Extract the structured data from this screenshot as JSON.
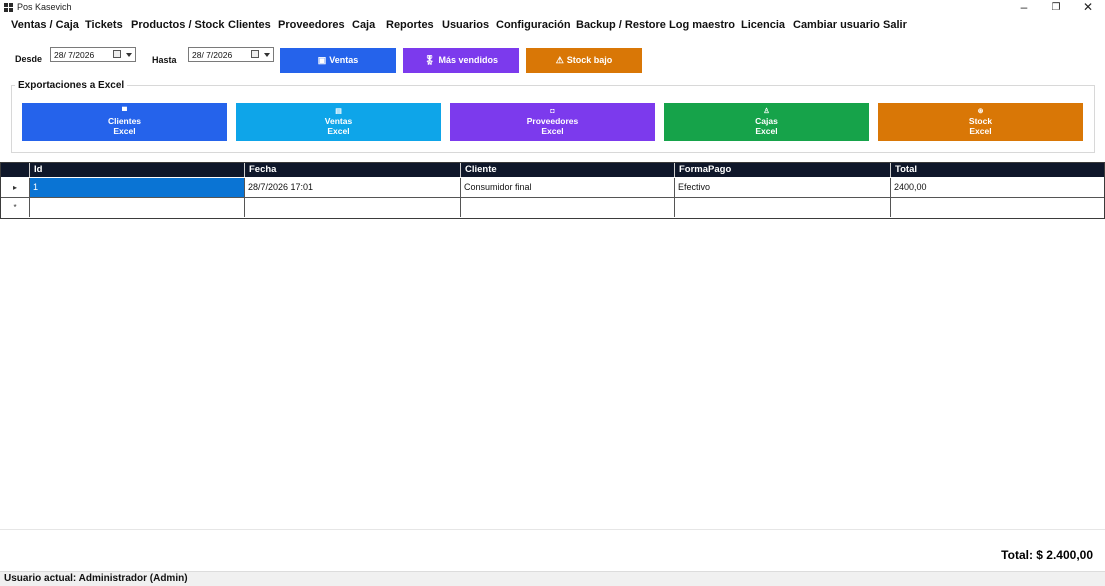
{
  "window": {
    "title": "Pos Kasevich",
    "minimize": "–",
    "restore": "❐",
    "close": "✕"
  },
  "menu": [
    "Ventas / Caja",
    "Tickets",
    "Productos / Stock",
    "Clientes",
    "Proveedores",
    "Caja",
    "Reportes",
    "Usuarios",
    "Configuración",
    "Backup / Restore",
    "Log maestro",
    "Licencia",
    "Cambiar usuario",
    "Salir"
  ],
  "filters": {
    "desde_label": "Desde",
    "desde_value": "28/ 7/2026",
    "hasta_label": "Hasta",
    "hasta_value": "28/ 7/2026"
  },
  "report_buttons": {
    "ventas": {
      "icon": "▣",
      "label": "Ventas",
      "color": "#2563eb"
    },
    "mas_vendidos": {
      "icon": "🎖",
      "label": "Más vendidos",
      "color": "#7c3aed"
    },
    "stock_bajo": {
      "icon": "⚠",
      "label": "Stock bajo",
      "color": "#d97706"
    }
  },
  "exports": {
    "title": "Exportaciones a Excel",
    "buttons": [
      {
        "icon": "▀",
        "line1": "Clientes",
        "line2": "Excel",
        "color": "#2563eb"
      },
      {
        "icon": "▤",
        "line1": "Ventas",
        "line2": "Excel",
        "color": "#0ea5e9"
      },
      {
        "icon": "◘",
        "line1": "Proveedores",
        "line2": "Excel",
        "color": "#7c3aed"
      },
      {
        "icon": "♙",
        "line1": "Cajas",
        "line2": "Excel",
        "color": "#16a34a"
      },
      {
        "icon": "⊛",
        "line1": "Stock",
        "line2": "Excel",
        "color": "#d97706"
      }
    ]
  },
  "table": {
    "columns": [
      "Id",
      "Fecha",
      "Cliente",
      "FormaPago",
      "Total"
    ],
    "rows": [
      [
        "1",
        "28/7/2026 17:01",
        "Consumidor final",
        "Efectivo",
        "2400,00"
      ]
    ],
    "current_row_marker": "▸",
    "new_row_marker": "*",
    "header_color": "#0f172a",
    "selection_color": "#0a74d4"
  },
  "total_label": "Total: $ 2.400,00",
  "status": "Usuario actual: Administrador (Admin)"
}
